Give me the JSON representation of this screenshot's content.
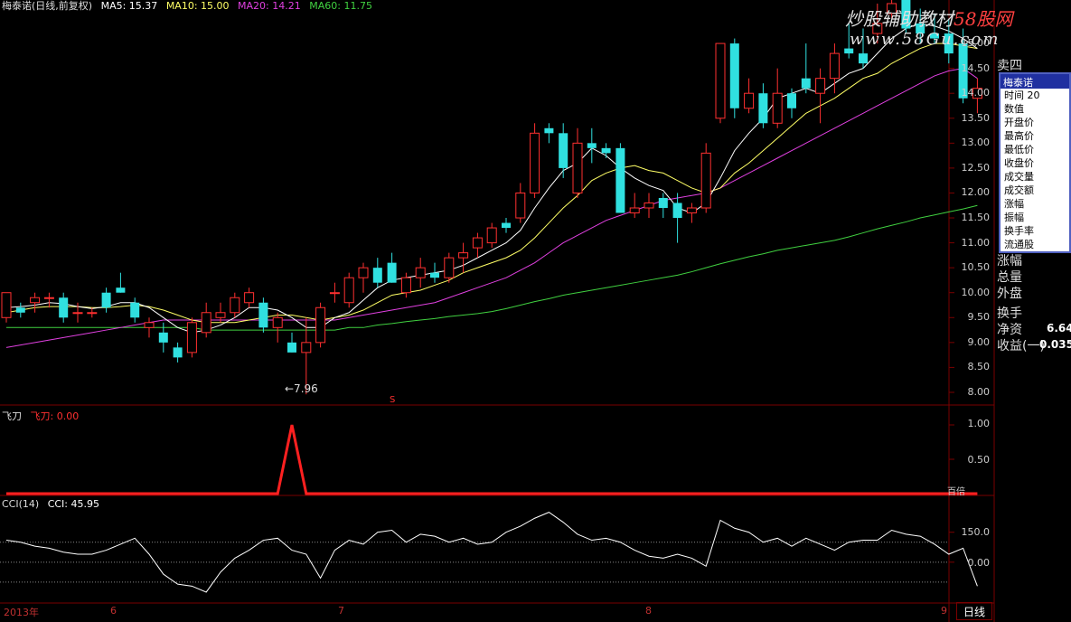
{
  "header": {
    "title": "梅泰诺(日线,前复权)",
    "ma5": "MA5: 15.37",
    "ma10": "MA10: 15.00",
    "ma20": "MA20: 14.21",
    "ma60": "MA60: 11.75"
  },
  "watermark": {
    "line1a": "炒股辅助教材",
    "line1b": "58股网",
    "line2": "www.58Gu.com"
  },
  "price_axis": [
    "15.00",
    "14.50",
    "14.00",
    "13.50",
    "13.00",
    "12.50",
    "12.00",
    "11.50",
    "11.00",
    "10.50",
    "10.00",
    "9.50",
    "9.00",
    "8.50",
    "8.00"
  ],
  "annotations": {
    "low_label": "←7.96",
    "marker_s": "S"
  },
  "feidao": {
    "name": "飞刀",
    "label": "飞刀: 0.00",
    "axis": [
      "1.00",
      "0.50"
    ],
    "unit": "百倍"
  },
  "cci": {
    "label_name": "CCI(14)",
    "label_val": "CCI: 45.95",
    "axis": [
      "150.0",
      "0.00"
    ]
  },
  "date_axis": [
    "2013年",
    "6",
    "7",
    "8",
    "9"
  ],
  "period_button": "日线",
  "side": {
    "sell4": "卖四",
    "info_title": "梅泰诺",
    "info_rows": [
      "时间  20",
      "数值",
      "开盘价",
      "最高价",
      "最低价",
      "收盘价",
      "成交量",
      "成交额",
      "涨幅",
      "振幅",
      "换手率",
      "流通股"
    ],
    "zhangfu": "涨幅",
    "zongliang": "总量",
    "waipan": "外盘",
    "huanshou": "换手",
    "jingzi": "净资",
    "jingzi_val": "6.64",
    "shouyi": "收益(一)",
    "shouyi_val": "0.035"
  },
  "colors": {
    "up": "#ff3030",
    "down": "#30e0e0",
    "ma5": "#ffffff",
    "ma10": "#ffff66",
    "ma20": "#e040e0",
    "ma60": "#40d040",
    "cci": "#ffffff",
    "feidao": "#ff2020"
  },
  "chart_data": {
    "type": "candlestick",
    "ylim": [
      7.8,
      15.6
    ],
    "candles": [
      [
        9.5,
        10.0,
        9.4,
        10.0
      ],
      [
        9.7,
        9.8,
        9.5,
        9.6
      ],
      [
        9.8,
        10.0,
        9.6,
        9.9
      ],
      [
        9.9,
        10.0,
        9.7,
        9.9
      ],
      [
        9.9,
        10.0,
        9.4,
        9.5
      ],
      [
        9.6,
        9.8,
        9.4,
        9.6
      ],
      [
        9.6,
        9.7,
        9.5,
        9.6
      ],
      [
        10.0,
        10.1,
        9.6,
        9.7
      ],
      [
        10.1,
        10.4,
        10.0,
        10.0
      ],
      [
        9.8,
        9.9,
        9.4,
        9.5
      ],
      [
        9.3,
        9.5,
        9.1,
        9.4
      ],
      [
        9.2,
        9.4,
        8.8,
        9.0
      ],
      [
        8.9,
        9.0,
        8.6,
        8.7
      ],
      [
        8.8,
        9.5,
        8.7,
        9.4
      ],
      [
        9.2,
        9.8,
        9.1,
        9.6
      ],
      [
        9.5,
        9.8,
        9.4,
        9.6
      ],
      [
        9.6,
        10.0,
        9.5,
        9.9
      ],
      [
        9.8,
        10.1,
        9.7,
        10.0
      ],
      [
        9.8,
        9.9,
        9.2,
        9.3
      ],
      [
        9.3,
        9.6,
        9.0,
        9.5
      ],
      [
        9.0,
        9.2,
        8.8,
        8.8
      ],
      [
        8.8,
        9.5,
        7.96,
        9.0
      ],
      [
        9.0,
        9.8,
        8.9,
        9.7
      ],
      [
        10.0,
        10.2,
        9.8,
        10.0
      ],
      [
        9.8,
        10.4,
        9.7,
        10.3
      ],
      [
        10.3,
        10.6,
        10.0,
        10.5
      ],
      [
        10.5,
        10.7,
        10.1,
        10.2
      ],
      [
        10.6,
        10.8,
        10.2,
        10.2
      ],
      [
        10.0,
        10.4,
        9.9,
        10.3
      ],
      [
        10.3,
        10.7,
        10.1,
        10.5
      ],
      [
        10.4,
        10.6,
        10.2,
        10.3
      ],
      [
        10.3,
        10.8,
        10.2,
        10.7
      ],
      [
        10.7,
        11.0,
        10.4,
        10.8
      ],
      [
        10.9,
        11.2,
        10.7,
        11.1
      ],
      [
        11.0,
        11.4,
        10.9,
        11.3
      ],
      [
        11.4,
        11.5,
        11.2,
        11.3
      ],
      [
        11.5,
        12.2,
        11.4,
        12.0
      ],
      [
        12.0,
        13.4,
        11.9,
        13.2
      ],
      [
        13.3,
        13.4,
        13.0,
        13.2
      ],
      [
        13.2,
        13.4,
        12.3,
        12.5
      ],
      [
        12.0,
        13.3,
        11.9,
        13.0
      ],
      [
        13.0,
        13.3,
        12.6,
        12.9
      ],
      [
        12.9,
        13.0,
        12.7,
        12.8
      ],
      [
        12.9,
        13.0,
        11.6,
        11.6
      ],
      [
        11.6,
        12.0,
        11.5,
        11.7
      ],
      [
        11.7,
        12.0,
        11.5,
        11.8
      ],
      [
        11.9,
        12.0,
        11.5,
        11.7
      ],
      [
        11.8,
        12.0,
        11.0,
        11.5
      ],
      [
        11.6,
        11.8,
        11.4,
        11.7
      ],
      [
        11.7,
        13.0,
        11.6,
        12.8
      ],
      [
        13.5,
        15.0,
        13.4,
        15.0
      ],
      [
        15.0,
        15.1,
        13.5,
        13.7
      ],
      [
        13.7,
        14.3,
        13.6,
        14.0
      ],
      [
        14.0,
        14.2,
        13.3,
        13.4
      ],
      [
        13.4,
        14.5,
        13.3,
        14.0
      ],
      [
        14.0,
        14.1,
        13.5,
        13.7
      ],
      [
        14.3,
        15.0,
        14.0,
        14.1
      ],
      [
        14.0,
        14.5,
        13.4,
        14.3
      ],
      [
        14.3,
        15.0,
        14.0,
        14.8
      ],
      [
        14.9,
        15.4,
        14.7,
        14.8
      ],
      [
        14.8,
        15.3,
        14.5,
        14.6
      ],
      [
        15.2,
        15.8,
        15.0,
        15.4
      ],
      [
        15.6,
        16.0,
        15.5,
        15.8
      ],
      [
        16.0,
        16.1,
        15.2,
        15.3
      ],
      [
        15.4,
        15.7,
        15.0,
        15.2
      ],
      [
        15.2,
        15.6,
        15.0,
        15.1
      ],
      [
        15.2,
        15.5,
        14.6,
        14.8
      ],
      [
        15.0,
        15.3,
        13.8,
        13.9
      ],
      [
        13.9,
        14.3,
        13.6,
        14.1
      ]
    ],
    "ma5": [
      9.7,
      9.72,
      9.75,
      9.8,
      9.78,
      9.72,
      9.68,
      9.72,
      9.8,
      9.8,
      9.7,
      9.5,
      9.3,
      9.2,
      9.25,
      9.35,
      9.5,
      9.7,
      9.7,
      9.65,
      9.5,
      9.3,
      9.3,
      9.5,
      9.6,
      9.85,
      10.1,
      10.25,
      10.3,
      10.35,
      10.4,
      10.45,
      10.55,
      10.7,
      10.85,
      11.0,
      11.25,
      11.7,
      12.1,
      12.45,
      12.6,
      12.9,
      12.75,
      12.5,
      12.3,
      12.15,
      12.05,
      11.7,
      11.6,
      11.8,
      12.3,
      12.85,
      13.2,
      13.5,
      13.9,
      14.0,
      14.1,
      14.0,
      14.2,
      14.4,
      14.5,
      14.8,
      15.1,
      15.3,
      15.4,
      15.35,
      15.25,
      15.1,
      14.9
    ],
    "ma10": [
      9.6,
      9.65,
      9.7,
      9.72,
      9.72,
      9.72,
      9.7,
      9.7,
      9.72,
      9.75,
      9.72,
      9.65,
      9.55,
      9.45,
      9.4,
      9.4,
      9.4,
      9.45,
      9.5,
      9.55,
      9.55,
      9.5,
      9.45,
      9.5,
      9.55,
      9.65,
      9.8,
      9.95,
      10.0,
      10.05,
      10.15,
      10.25,
      10.4,
      10.5,
      10.6,
      10.7,
      10.85,
      11.1,
      11.4,
      11.7,
      11.95,
      12.25,
      12.4,
      12.5,
      12.55,
      12.45,
      12.4,
      12.25,
      12.1,
      12.0,
      12.1,
      12.4,
      12.6,
      12.85,
      13.1,
      13.35,
      13.6,
      13.75,
      13.9,
      14.1,
      14.3,
      14.4,
      14.6,
      14.75,
      14.9,
      15.0,
      15.0,
      14.95,
      14.9
    ],
    "ma20": [
      8.9,
      8.95,
      9.0,
      9.05,
      9.1,
      9.15,
      9.2,
      9.25,
      9.3,
      9.35,
      9.4,
      9.45,
      9.45,
      9.45,
      9.45,
      9.45,
      9.45,
      9.45,
      9.45,
      9.45,
      9.45,
      9.45,
      9.45,
      9.45,
      9.5,
      9.55,
      9.6,
      9.65,
      9.7,
      9.75,
      9.8,
      9.9,
      10.0,
      10.1,
      10.2,
      10.3,
      10.45,
      10.6,
      10.8,
      11.0,
      11.15,
      11.3,
      11.45,
      11.55,
      11.65,
      11.75,
      11.85,
      11.9,
      11.95,
      12.0,
      12.1,
      12.25,
      12.4,
      12.55,
      12.7,
      12.85,
      13.0,
      13.15,
      13.3,
      13.45,
      13.6,
      13.75,
      13.9,
      14.05,
      14.2,
      14.35,
      14.45,
      14.5,
      14.3
    ],
    "ma60": [
      9.3,
      9.3,
      9.3,
      9.3,
      9.3,
      9.3,
      9.3,
      9.3,
      9.3,
      9.3,
      9.3,
      9.3,
      9.3,
      9.3,
      9.25,
      9.25,
      9.25,
      9.25,
      9.25,
      9.25,
      9.25,
      9.25,
      9.25,
      9.25,
      9.3,
      9.3,
      9.35,
      9.38,
      9.42,
      9.45,
      9.48,
      9.52,
      9.55,
      9.58,
      9.62,
      9.68,
      9.75,
      9.82,
      9.88,
      9.95,
      10.0,
      10.05,
      10.1,
      10.15,
      10.2,
      10.25,
      10.3,
      10.35,
      10.42,
      10.5,
      10.58,
      10.65,
      10.72,
      10.78,
      10.85,
      10.9,
      10.95,
      11.0,
      11.05,
      11.12,
      11.2,
      11.28,
      11.35,
      11.42,
      11.5,
      11.56,
      11.62,
      11.68,
      11.75
    ],
    "feidao": [
      0,
      0,
      0,
      0,
      0,
      0,
      0,
      0,
      0,
      0,
      0,
      0,
      0,
      0,
      0,
      0,
      0,
      0,
      0,
      0,
      1,
      0,
      0,
      0,
      0,
      0,
      0,
      0,
      0,
      0,
      0,
      0,
      0,
      0,
      0,
      0,
      0,
      0,
      0,
      0,
      0,
      0,
      0,
      0,
      0,
      0,
      0,
      0,
      0,
      0,
      0,
      0,
      0,
      0,
      0,
      0,
      0,
      0,
      0,
      0,
      0,
      0,
      0,
      0,
      0,
      0,
      0,
      0,
      0
    ],
    "cci": [
      110,
      100,
      80,
      70,
      50,
      40,
      40,
      60,
      90,
      120,
      40,
      -60,
      -110,
      -120,
      -150,
      -50,
      20,
      60,
      110,
      120,
      60,
      40,
      -80,
      60,
      110,
      90,
      150,
      160,
      100,
      140,
      130,
      100,
      120,
      90,
      100,
      150,
      180,
      220,
      250,
      200,
      140,
      110,
      120,
      100,
      60,
      30,
      20,
      40,
      20,
      -20,
      210,
      170,
      150,
      100,
      120,
      80,
      120,
      90,
      60,
      100,
      110,
      110,
      160,
      140,
      130,
      90,
      40,
      70,
      -120
    ]
  }
}
